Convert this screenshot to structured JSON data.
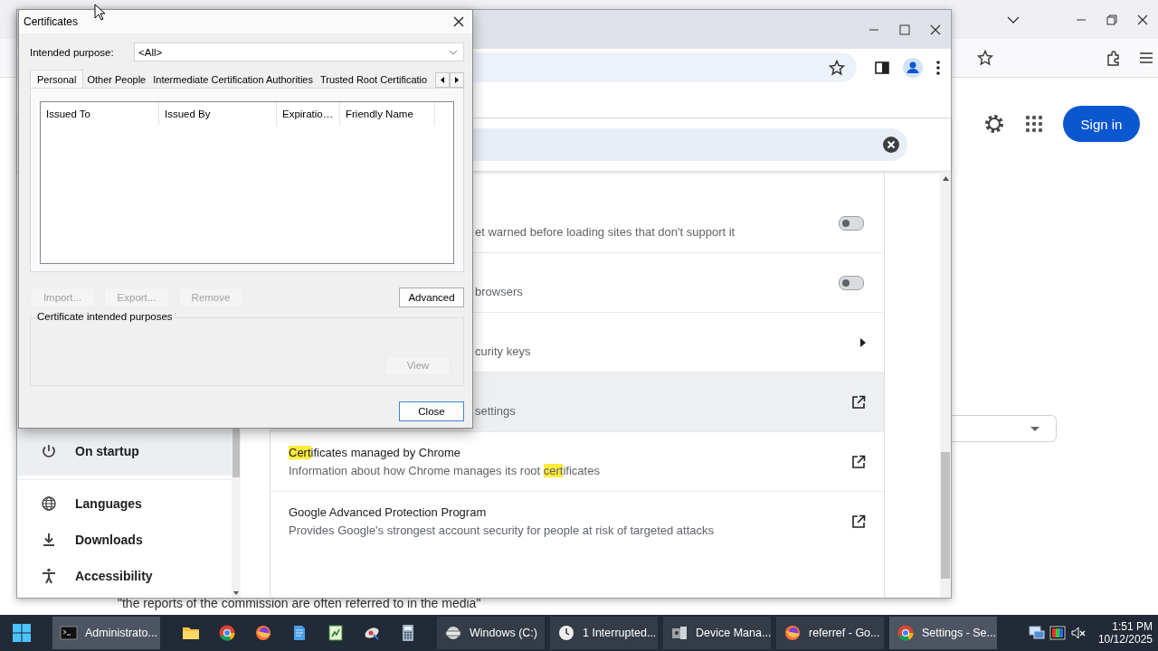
{
  "firefox": {
    "sign_in": "Sign in",
    "quote": "\"the reports of the commission are often referred to in the media\""
  },
  "chrome": {
    "sidebar": {
      "items": [
        {
          "label": "On startup",
          "selected": true
        },
        {
          "label": "Languages",
          "selected": false
        },
        {
          "label": "Downloads",
          "selected": false
        },
        {
          "label": "Accessibility",
          "selected": false
        }
      ]
    },
    "rows": [
      {
        "kind": "toggle",
        "partial": true,
        "hovered": false,
        "on": false,
        "subtitle": [
          {
            "text": "et warned before loading sites that don't support it",
            "highlight": false
          }
        ]
      },
      {
        "kind": "toggle",
        "partial": true,
        "hovered": false,
        "on": false,
        "subtitle": [
          {
            "text": "browsers",
            "highlight": false
          }
        ]
      },
      {
        "kind": "arrow",
        "partial": true,
        "hovered": false,
        "subtitle": [
          {
            "text": "curity keys",
            "highlight": false
          }
        ]
      },
      {
        "kind": "external",
        "partial": true,
        "hovered": true,
        "subtitle": [
          {
            "text": "settings",
            "highlight": false
          }
        ]
      },
      {
        "kind": "external",
        "partial": false,
        "hovered": false,
        "title": [
          {
            "text": "Cert",
            "highlight": true
          },
          {
            "text": "ificates managed by Chrome",
            "highlight": false
          }
        ],
        "subtitle": [
          {
            "text": "Information about how Chrome manages its root ",
            "highlight": false
          },
          {
            "text": "cert",
            "highlight": true
          },
          {
            "text": "ificates",
            "highlight": false
          }
        ]
      },
      {
        "kind": "external",
        "partial": false,
        "hovered": false,
        "title": [
          {
            "text": "Google Advanced Protection Program",
            "highlight": false
          }
        ],
        "subtitle": [
          {
            "text": "Provides Google's strongest account security for people at risk of targeted attacks",
            "highlight": false
          }
        ]
      }
    ]
  },
  "dialog": {
    "title": "Certificates",
    "purpose_label": "Intended purpose:",
    "purpose_value": "<All>",
    "tabs": [
      {
        "label": "Personal",
        "selected": true
      },
      {
        "label": "Other People",
        "selected": false
      },
      {
        "label": "Intermediate Certification Authorities",
        "selected": false
      },
      {
        "label": "Trusted Root Certificatio",
        "selected": false
      }
    ],
    "columns": [
      "Issued To",
      "Issued By",
      "Expiratio…",
      "Friendly Name"
    ],
    "buttons": [
      {
        "label": "Import...",
        "disabled": true
      },
      {
        "label": "Export...",
        "disabled": true
      },
      {
        "label": "Remove",
        "disabled": true
      },
      {
        "label": "Advanced",
        "disabled": false
      }
    ],
    "group": {
      "title": "Certificate intended purposes",
      "button": {
        "label": "View",
        "disabled": true
      }
    },
    "close_button": "Close"
  },
  "taskbar": {
    "buttons": [
      {
        "label": "Administrato...",
        "selected": true
      },
      {
        "label": "Windows (C:)",
        "selected": false
      },
      {
        "label": "1 Interrupted...",
        "selected": false
      },
      {
        "label": "Device Mana...",
        "selected": false
      },
      {
        "label": "referref - Go...",
        "selected": false
      },
      {
        "label": "Settings - Se...",
        "selected": true
      }
    ],
    "time": "1:51 PM",
    "date": "10/12/2025"
  }
}
